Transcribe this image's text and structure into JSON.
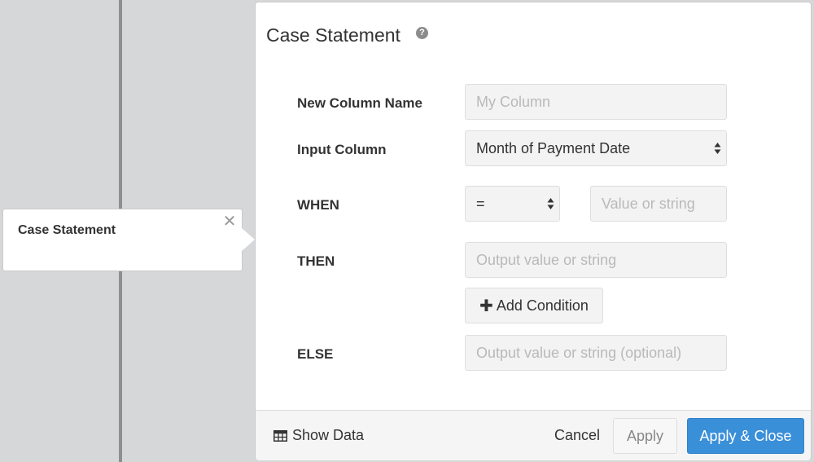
{
  "step_card": {
    "title": "Case Statement",
    "close_glyph": "✕"
  },
  "modal": {
    "title": "Case Statement",
    "help_glyph": "?",
    "new_column": {
      "label": "New Column Name",
      "placeholder": "My Column"
    },
    "input_column": {
      "label": "Input Column",
      "value": "Month of Payment Date"
    },
    "when": {
      "label": "WHEN",
      "operator": "=",
      "value_placeholder": "Value or string"
    },
    "then": {
      "label": "THEN",
      "placeholder": "Output value or string"
    },
    "add_condition_label": "Add Condition",
    "add_condition_glyph": "✚",
    "else": {
      "label": "ELSE",
      "placeholder": "Output value or string (optional)"
    }
  },
  "footer": {
    "show_data_label": "Show Data",
    "cancel_label": "Cancel",
    "apply_label": "Apply",
    "apply_close_label": "Apply & Close"
  },
  "colors": {
    "primary": "#3a8fd9",
    "background": "#d6d7d9",
    "divider": "#8e8f91"
  },
  "icons": [
    "close-icon",
    "help-icon",
    "plus-icon",
    "table-icon",
    "select-arrows-icon"
  ]
}
